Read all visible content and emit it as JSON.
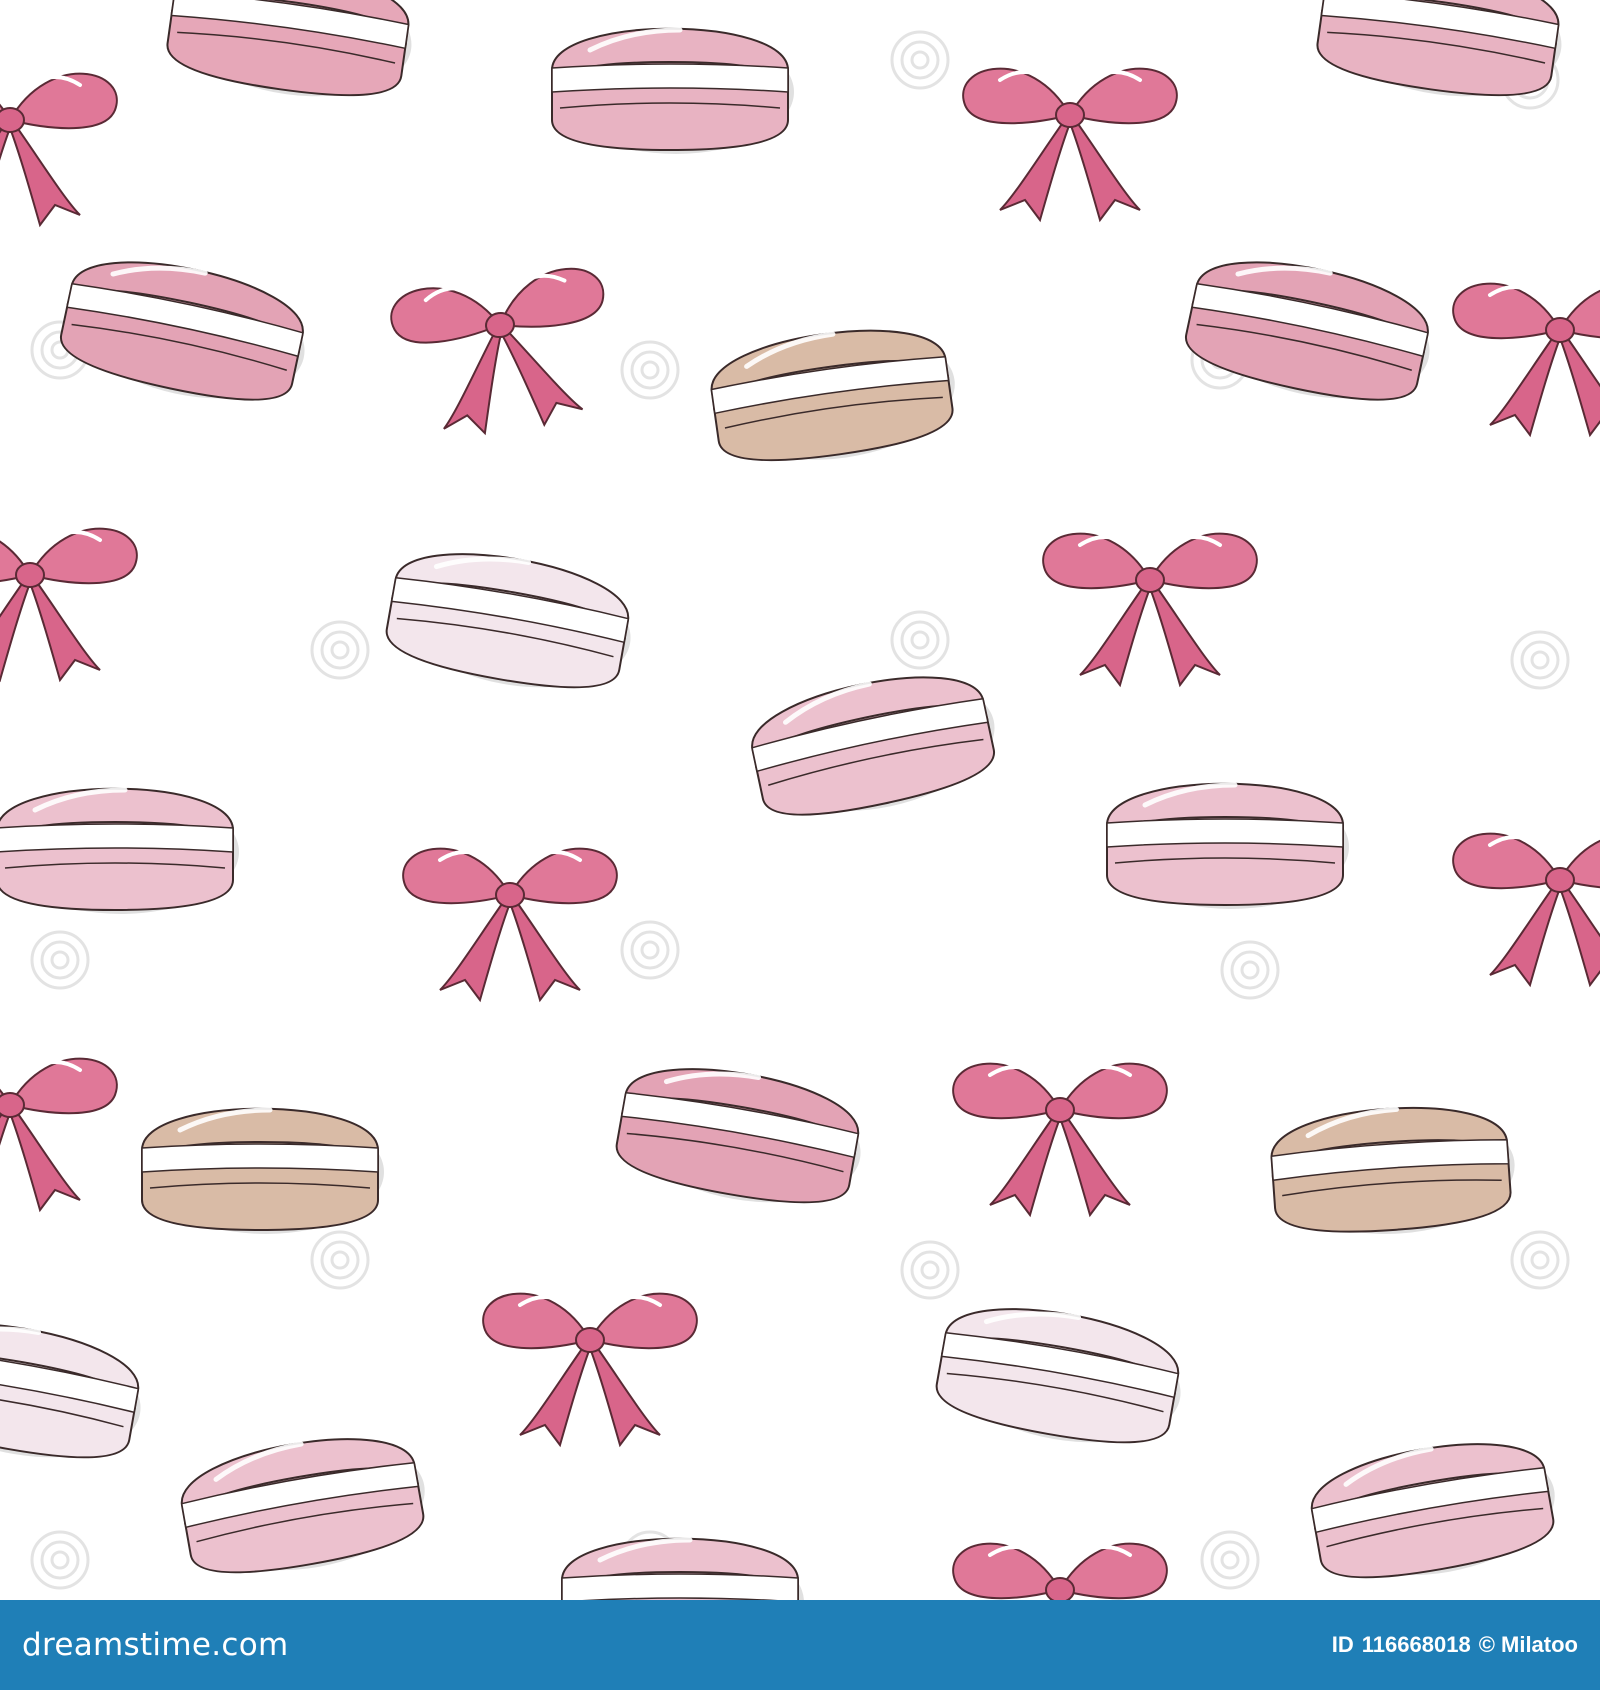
{
  "colors": {
    "background": "#ffffff",
    "footer_bar": "#1f7fb7",
    "footer_text": "#ffffff",
    "bow_pink": "#e07898",
    "macaron_palette": [
      "#e6a7b8",
      "#ecc1ce",
      "#d9bba6",
      "#f3e6ec"
    ],
    "watermark": "#e3e3e3"
  },
  "pattern": {
    "motifs": [
      "macaron-icon",
      "bow-icon",
      "spiral-watermark-icon"
    ]
  },
  "footer": {
    "brand": "dreamstime.com",
    "id_label": "ID",
    "id_number": "116668018",
    "author": "© Milatoo"
  }
}
